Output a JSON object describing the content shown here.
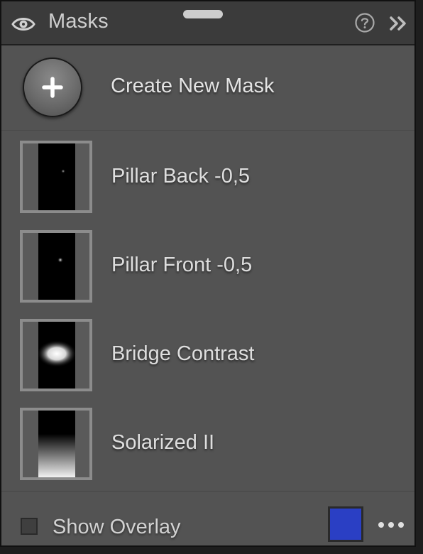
{
  "header": {
    "title": "Masks",
    "icons": {
      "visibility": "eye-icon",
      "help": "help-circle-icon",
      "collapse": "double-chevron-right-icon"
    }
  },
  "create": {
    "label": "Create New Mask",
    "icon": "plus-icon"
  },
  "masks": [
    {
      "name": "Pillar Back -0,5"
    },
    {
      "name": "Pillar Front -0,5"
    },
    {
      "name": "Bridge Contrast"
    },
    {
      "name": "Solarized II"
    }
  ],
  "footer": {
    "show_overlay_label": "Show Overlay",
    "show_overlay_checked": false,
    "overlay_color": "#2a3fc4",
    "more_icon": "more-horizontal-icon"
  },
  "colors": {
    "panel_bg": "#535353",
    "header_bg": "#3b3b3b",
    "text": "#dedede"
  }
}
